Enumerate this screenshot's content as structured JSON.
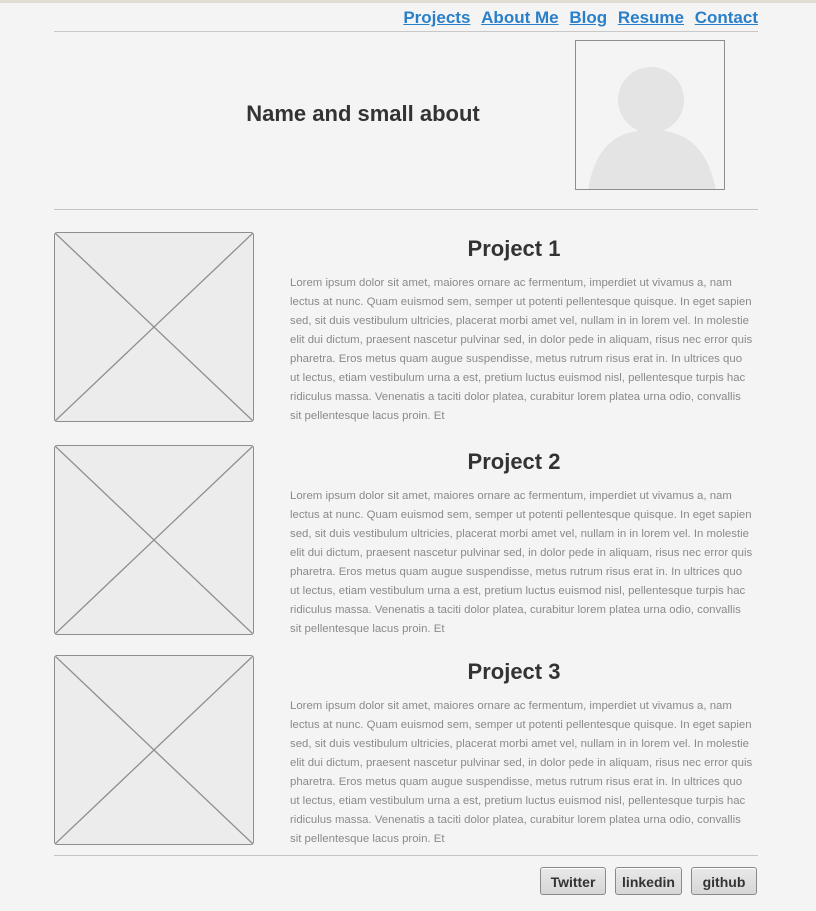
{
  "nav": {
    "items": [
      "Projects",
      "About Me",
      "Blog",
      "Resume",
      "Contact"
    ]
  },
  "hero": {
    "name": "Name and small about",
    "avatar_icon": "user-avatar-placeholder-icon"
  },
  "projects": [
    {
      "title": "Project 1",
      "description": "Lorem ipsum dolor sit amet, maiores ornare ac fermentum, imperdiet ut vivamus a, nam lectus at nunc. Quam euismod sem, semper ut potenti pellentesque quisque. In eget sapien sed, sit duis vestibulum ultricies, placerat morbi amet vel, nullam in in lorem vel. In molestie elit dui dictum, praesent nascetur pulvinar sed, in dolor pede in aliquam, risus nec error quis pharetra. Eros metus quam augue suspendisse, metus rutrum risus erat in.  In ultrices quo ut lectus, etiam vestibulum urna a est, pretium luctus euismod nisl, pellentesque turpis hac ridiculus massa. Venenatis a taciti dolor platea, curabitur lorem platea urna odio, convallis sit pellentesque lacus proin. Et",
      "image_icon": "image-placeholder-icon"
    },
    {
      "title": "Project 2",
      "description": "Lorem ipsum dolor sit amet, maiores ornare ac fermentum, imperdiet ut vivamus a, nam lectus at nunc. Quam euismod sem, semper ut potenti pellentesque quisque. In eget sapien sed, sit duis vestibulum ultricies, placerat morbi amet vel, nullam in in lorem vel. In molestie elit dui dictum, praesent nascetur pulvinar sed, in dolor pede in aliquam, risus nec error quis pharetra. Eros metus quam augue suspendisse, metus rutrum risus erat in.  In ultrices quo ut lectus, etiam vestibulum urna a est, pretium luctus euismod nisl, pellentesque turpis hac ridiculus massa. Venenatis a taciti dolor platea, curabitur lorem platea urna odio, convallis sit pellentesque lacus proin. Et",
      "image_icon": "image-placeholder-icon"
    },
    {
      "title": "Project 3",
      "description": "Lorem ipsum dolor sit amet, maiores ornare ac fermentum, imperdiet ut vivamus a, nam lectus at nunc. Quam euismod sem, semper ut potenti pellentesque quisque. In eget sapien sed, sit duis vestibulum ultricies, placerat morbi amet vel, nullam in in lorem vel. In molestie elit dui dictum, praesent nascetur pulvinar sed, in dolor pede in aliquam, risus nec error quis pharetra. Eros metus quam augue suspendisse, metus rutrum risus erat in.  In ultrices quo ut lectus, etiam vestibulum urna a est, pretium luctus euismod nisl, pellentesque turpis hac ridiculus massa. Venenatis a taciti dolor platea, curabitur lorem platea urna odio, convallis sit pellentesque lacus proin. Et",
      "image_icon": "image-placeholder-icon"
    }
  ],
  "footer": {
    "buttons": [
      "Twitter",
      "linkedin",
      "github"
    ]
  },
  "colors": {
    "link": "#2a7fc9",
    "background": "#f4f4f4",
    "text": "#333333",
    "muted_text": "#8a8a8a"
  }
}
